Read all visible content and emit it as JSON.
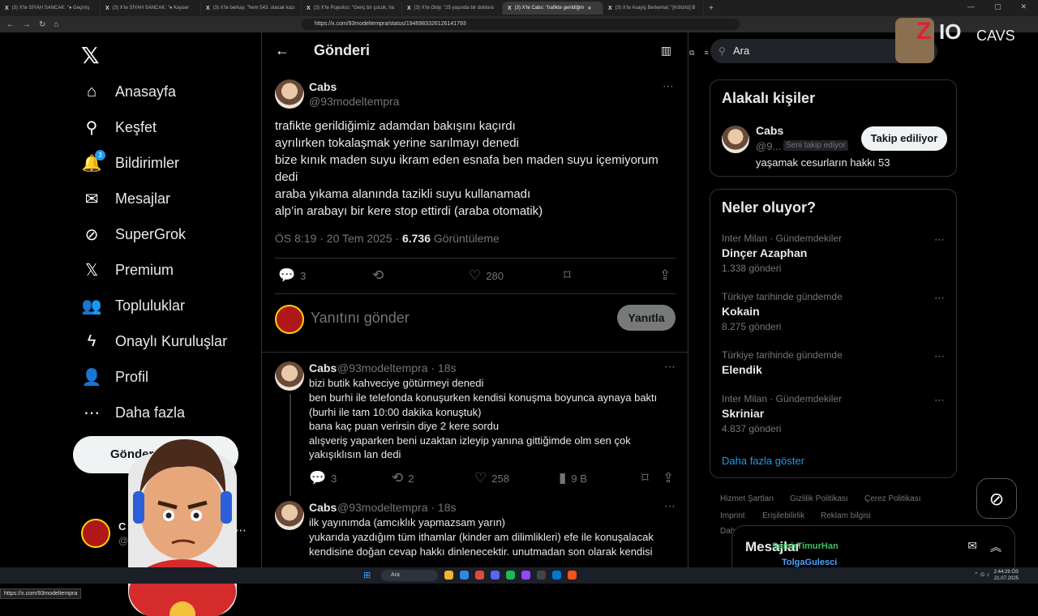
{
  "browser": {
    "tabs": [
      {
        "label": "(3) X'te SİYAH SANCAK: \"● Geçmiş"
      },
      {
        "label": "(3) X'te SİYAH SANCAK: \"● Kayser"
      },
      {
        "label": "(3) X'te berkay: \"hem 543. olacak kazı"
      },
      {
        "label": "(3) X'te Populico: \"Genç bir çocuk, ha"
      },
      {
        "label": "(3) X'te Gldy: \"25 yaşında bir doktora"
      },
      {
        "label": "(3) X'te Cabs: \"trafikte gerildiğim"
      },
      {
        "label": "(3) X'te Asayiş Berkemal: \"[Kötürlü] B"
      }
    ],
    "url": "https://x.com/93modeltempra/status/1946983326126141793",
    "status_url": "https://x.com/93modeltempra"
  },
  "sidebar": {
    "items": [
      {
        "label": "Anasayfa",
        "icon": "home-icon",
        "glyph": "⌂"
      },
      {
        "label": "Keşfet",
        "icon": "search-icon",
        "glyph": "⚲"
      },
      {
        "label": "Bildirimler",
        "icon": "bell-icon",
        "glyph": "🔔",
        "badge": "3"
      },
      {
        "label": "Mesajlar",
        "icon": "mail-icon",
        "glyph": "✉"
      },
      {
        "label": "SuperGrok",
        "icon": "grok-icon",
        "glyph": "⊘"
      },
      {
        "label": "Premium",
        "icon": "x-premium-icon",
        "glyph": "𝕏"
      },
      {
        "label": "Topluluklar",
        "icon": "community-icon",
        "glyph": "👥"
      },
      {
        "label": "Onaylı Kuruluşlar",
        "icon": "lightning-icon",
        "glyph": "ϟ"
      },
      {
        "label": "Profil",
        "icon": "profile-icon",
        "glyph": "👤"
      },
      {
        "label": "Daha fazla",
        "icon": "more-circle-icon",
        "glyph": "⋯"
      }
    ],
    "post_label": "Gönder",
    "account_name": "C",
    "account_handle": "@c"
  },
  "main": {
    "header_title": "Gönderi",
    "tweet": {
      "name": "Cabs",
      "handle": "@93modeltempra",
      "lines": [
        "trafikte gerildiğimiz adamdan bakışını kaçırdı",
        "ayrılırken tokalaşmak yerine sarılmayı denedi",
        "bize kınık maden suyu ikram eden esnafa ben maden suyu içemiyorum",
        "dedi",
        "araba yıkama alanında tazikli suyu kullanamadı",
        "alp’in arabayı bir kere stop ettirdi (araba otomatik)"
      ],
      "time": "ÖS 8:19 · 20 Tem 2025 · ",
      "views": "6.736",
      "views_label": " Görüntüleme",
      "replies": "3",
      "likes": "280"
    },
    "reply_placeholder": "Yanıtını gönder",
    "reply_button": "Yanıtla",
    "replies": [
      {
        "name": "Cabs",
        "handle": "@93modeltempra · 18s",
        "lines": [
          "bizi butik kahveciye götürmeyi denedi",
          "ben burhi ile telefonda konuşurken kendisi konuşma boyunca aynaya baktı",
          "(burhi ile tam 10:00 dakika konuştuk)",
          "bana kaç puan verirsin diye 2 kere sordu",
          "alışveriş yaparken beni uzaktan izleyip yanına gittiğimde olm sen çok",
          "yakışıklısın lan dedi"
        ],
        "replies": "3",
        "reposts": "2",
        "likes": "258",
        "views": "9 B"
      },
      {
        "name": "Cabs",
        "handle": "@93modeltempra · 18s",
        "lines": [
          "ilk yayınımda (amcıklık yapmazsam yarın)",
          "yukarıda yazdığım tüm ithamlar (kinder am dilimlikleri) efe ile konuşalacak",
          "kendisine doğan cevap hakkı dinlenecektir. unutmadan son olarak kendisi"
        ]
      }
    ]
  },
  "right": {
    "search_placeholder": "Ara",
    "related_title": "Alakalı kişiler",
    "related": {
      "name": "Cabs",
      "handle": "@9...",
      "follows_you": "Seni takip ediyor",
      "button": "Takip ediliyor",
      "bio": "yaşamak cesurların hakkı 53"
    },
    "trends_title": "Neler oluyor?",
    "trends": [
      {
        "category": "Inter Milan · Gündemdekiler",
        "title": "Dinçer Azaphan",
        "count": "1.338 gönderi"
      },
      {
        "category": "Türkiye tarihinde gündemde",
        "title": "Kokain",
        "count": "8.275 gönderi"
      },
      {
        "category": "Türkiye tarihinde gündemde",
        "title": "Elendik",
        "count": ""
      },
      {
        "category": "Inter Milan · Gündemdekiler",
        "title": "Skriniar",
        "count": "4.837 gönderi"
      }
    ],
    "show_more": "Daha fazla göster",
    "footer": [
      "Hizmet Şartları",
      "Gizlilik Politikası",
      "Çerez Politikası",
      "Imprint",
      "Erişilebilirlik",
      "Reklam bilgisi",
      "Dah"
    ],
    "messages_title": "Mesajlar",
    "chat": [
      "SamirTimurHan",
      "TolgaGulesci"
    ]
  },
  "overlay": {
    "logo_text": "CAVS"
  },
  "taskbar": {
    "search": "Ara",
    "time": "2:44:29 ÖS",
    "date": "21.07.2025"
  }
}
